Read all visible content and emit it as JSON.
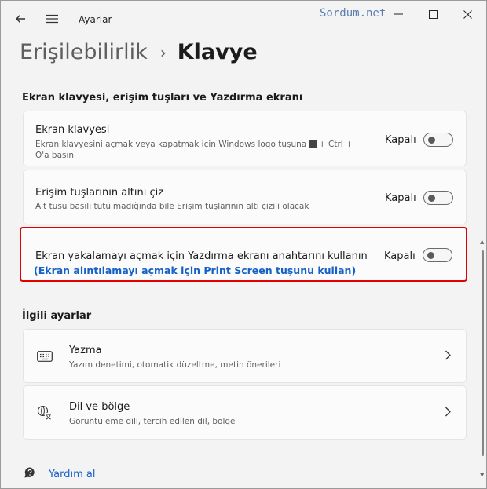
{
  "titlebar": {
    "app_title": "Ayarlar",
    "watermark": "Sordum.net",
    "back_icon": "back-arrow-icon",
    "menu_icon": "hamburger-menu-icon",
    "minimize_icon": "minimize-icon",
    "maximize_icon": "maximize-icon",
    "close_icon": "close-icon"
  },
  "breadcrumb": {
    "parent": "Erişilebilirlik",
    "separator": "›",
    "current": "Klavye"
  },
  "section1": {
    "title": "Ekran klavyesi, erişim tuşları ve Yazdırma ekranı",
    "items": [
      {
        "title": "Ekran klavyesi",
        "desc_line1": "Ekran klavyesini açmak veya kapatmak için Windows logo tuşuna",
        "desc_key": "+ Ctrl +",
        "desc_line2": "O'a basın",
        "status": "Kapalı",
        "toggle_on": false
      },
      {
        "title": "Erişim tuşlarının altını çiz",
        "desc": "Alt tuşu basılı tutulmadığında bile Erişim tuşlarının altı çizili olacak",
        "status": "Kapalı",
        "toggle_on": false
      },
      {
        "title": "Ekran yakalamayı açmak için Yazdırma ekranı anahtarını kullanın",
        "note": "(Ekran alıntılamayı açmak için Print Screen tuşunu kullan)",
        "status": "Kapalı",
        "toggle_on": false
      }
    ]
  },
  "section2": {
    "title": "İlgili ayarlar",
    "items": [
      {
        "icon": "keyboard-icon",
        "title": "Yazma",
        "desc": "Yazım denetimi, otomatik düzeltme, metin önerileri"
      },
      {
        "icon": "language-icon",
        "title": "Dil ve bölge",
        "desc": "Görüntüleme dili, tercih edilen dil, bölge"
      }
    ]
  },
  "help": {
    "icon": "help-icon",
    "label": "Yardım al"
  },
  "colors": {
    "accent": "#1561c7",
    "highlight_border": "#e00000",
    "background": "#f3f3f3",
    "card": "#fbfbfb"
  }
}
